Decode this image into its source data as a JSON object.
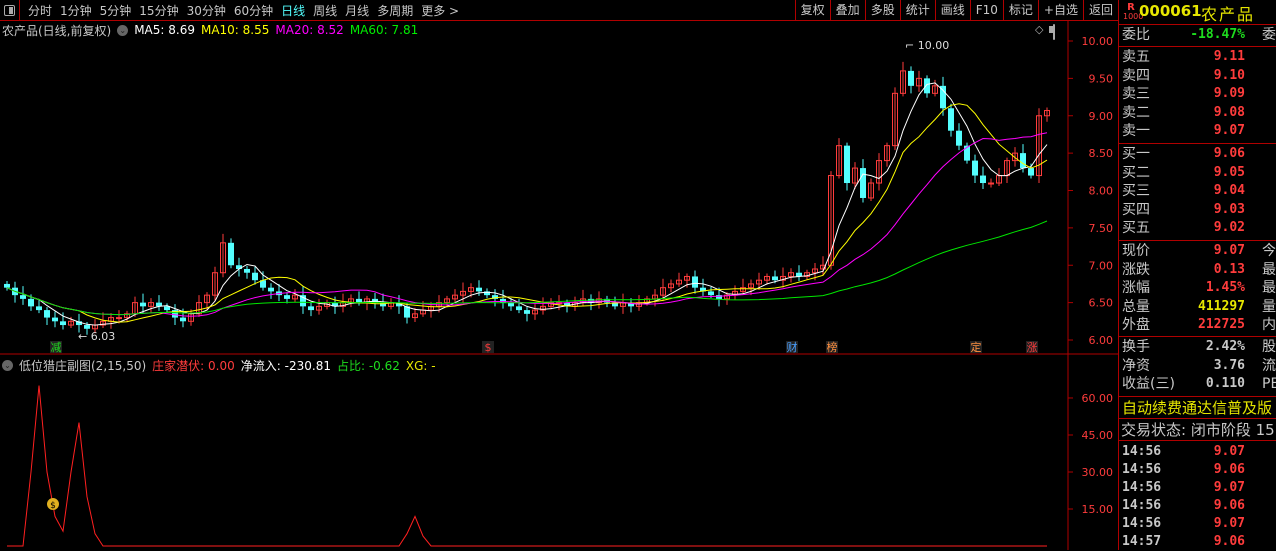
{
  "toolbar": {
    "periods": [
      "分时",
      "1分钟",
      "5分钟",
      "15分钟",
      "30分钟",
      "60分钟",
      "日线",
      "周线",
      "月线",
      "多周期",
      "更多 >"
    ],
    "active": "日线",
    "right": [
      "复权",
      "叠加",
      "多股",
      "统计",
      "画线",
      "F10",
      "标记",
      "+自选",
      "返回"
    ]
  },
  "chart_title": {
    "name": "农产品(日线,前复权)",
    "ma5": "MA5: 8.69",
    "ma10": "MA10: 8.55",
    "ma20": "MA20: 8.52",
    "ma60": "MA60: 7.81"
  },
  "colors": {
    "up": "#ff3c3c",
    "down": "#54ffff",
    "ma5": "#ffffff",
    "ma10": "#ffff00",
    "ma20": "#ff00ff",
    "ma60": "#00e600",
    "grid": "#b00000"
  },
  "price_axis": [
    "10.00",
    "9.50",
    "9.00",
    "8.50",
    "8.00",
    "7.50",
    "7.00",
    "6.50",
    "6.00"
  ],
  "price_axis_values": [
    10,
    9.5,
    9,
    8.5,
    8,
    7.5,
    7,
    6.5,
    6
  ],
  "high_label": "10.00",
  "low_label": "6.03",
  "markers": [
    {
      "i": 6,
      "t": "减",
      "c": "#1edc1e"
    },
    {
      "i": 60,
      "t": "$",
      "c": "#ff3c3c"
    },
    {
      "i": 98,
      "t": "财",
      "c": "#4aa0ff"
    },
    {
      "i": 103,
      "t": "榜",
      "c": "#ff9040"
    },
    {
      "i": 121,
      "t": "定",
      "c": "#ff9040"
    },
    {
      "i": 128,
      "t": "涨",
      "c": "#ff3c3c"
    }
  ],
  "chart_data": {
    "type": "candlestick",
    "ylim": [
      6,
      10
    ],
    "closes": [
      6.7,
      6.6,
      6.55,
      6.45,
      6.4,
      6.3,
      6.25,
      6.2,
      6.25,
      6.2,
      6.15,
      6.2,
      6.25,
      6.3,
      6.3,
      6.35,
      6.5,
      6.45,
      6.5,
      6.45,
      6.4,
      6.3,
      6.25,
      6.35,
      6.5,
      6.6,
      6.9,
      7.3,
      7.0,
      6.95,
      6.9,
      6.8,
      6.7,
      6.65,
      6.6,
      6.55,
      6.6,
      6.45,
      6.4,
      6.45,
      6.5,
      6.45,
      6.5,
      6.55,
      6.5,
      6.55,
      6.5,
      6.45,
      6.5,
      6.45,
      6.3,
      6.35,
      6.4,
      6.45,
      6.5,
      6.55,
      6.6,
      6.65,
      6.7,
      6.65,
      6.6,
      6.55,
      6.5,
      6.45,
      6.4,
      6.35,
      6.4,
      6.45,
      6.5,
      6.5,
      6.45,
      6.5,
      6.55,
      6.5,
      6.55,
      6.5,
      6.45,
      6.5,
      6.45,
      6.5,
      6.55,
      6.6,
      6.7,
      6.75,
      6.8,
      6.85,
      6.7,
      6.65,
      6.6,
      6.55,
      6.6,
      6.65,
      6.7,
      6.75,
      6.8,
      6.85,
      6.8,
      6.85,
      6.9,
      6.85,
      6.9,
      6.95,
      7.0,
      8.2,
      8.6,
      8.1,
      8.3,
      7.9,
      8.1,
      8.4,
      8.6,
      9.3,
      9.6,
      9.4,
      9.5,
      9.3,
      9.4,
      9.1,
      8.8,
      8.6,
      8.4,
      8.2,
      8.1,
      8.1,
      8.2,
      8.4,
      8.5,
      8.3,
      8.2,
      9.0,
      9.07
    ]
  },
  "indicator": {
    "title": "低位猎庄副图(2,15,50)",
    "zj_label": "庄家潜伏:",
    "zj_value": "0.00",
    "jl_label": "净流入:",
    "jl_value": "-230.81",
    "zb_label": "占比:",
    "zb_value": "-0.62",
    "xg": "XG: -",
    "axis": [
      "60.00",
      "45.00",
      "30.00",
      "15.00"
    ],
    "axis_values": [
      60,
      45,
      30,
      15
    ],
    "values": {
      "3": 30,
      "4": 65,
      "5": 30,
      "6": 12,
      "7": 6,
      "8": 30,
      "9": 50,
      "10": 20,
      "11": 5,
      "50": 5,
      "51": 12,
      "52": 4
    }
  },
  "panel": {
    "code": "000061",
    "name": "农产品",
    "badge_r": "R",
    "badge_n": "1000",
    "wb": {
      "label": "委比",
      "value": "-18.47%",
      "extra": "委"
    },
    "asks": [
      {
        "l": "卖五",
        "v": "9.11"
      },
      {
        "l": "卖四",
        "v": "9.10"
      },
      {
        "l": "卖三",
        "v": "9.09"
      },
      {
        "l": "卖二",
        "v": "9.08"
      },
      {
        "l": "卖一",
        "v": "9.07"
      }
    ],
    "bids": [
      {
        "l": "买一",
        "v": "9.06"
      },
      {
        "l": "买二",
        "v": "9.05"
      },
      {
        "l": "买三",
        "v": "9.04"
      },
      {
        "l": "买四",
        "v": "9.03"
      },
      {
        "l": "买五",
        "v": "9.02"
      }
    ],
    "info1": [
      {
        "l": "现价",
        "v": "9.07",
        "x": "今",
        "c": "red"
      },
      {
        "l": "涨跌",
        "v": "0.13",
        "x": "最",
        "c": "red"
      },
      {
        "l": "涨幅",
        "v": "1.45%",
        "x": "最",
        "c": "red"
      },
      {
        "l": "总量",
        "v": "411297",
        "x": "量",
        "c": "yellow"
      },
      {
        "l": "外盘",
        "v": "212725",
        "x": "内",
        "c": "red"
      }
    ],
    "info2": [
      {
        "l": "换手",
        "v": "2.42%",
        "x": "股"
      },
      {
        "l": "净资",
        "v": "3.76",
        "x": "流"
      },
      {
        "l": "收益(三)",
        "v": "0.110",
        "x": "PE"
      }
    ],
    "notice": "自动续费通达信普及版",
    "status": "交易状态: 闭市阶段 15",
    "ticks": [
      {
        "t": "14:56",
        "p": "9.07"
      },
      {
        "t": "14:56",
        "p": "9.06"
      },
      {
        "t": "14:56",
        "p": "9.07"
      },
      {
        "t": "14:56",
        "p": "9.06"
      },
      {
        "t": "14:56",
        "p": "9.07"
      },
      {
        "t": "14:57",
        "p": "9.06"
      }
    ]
  }
}
